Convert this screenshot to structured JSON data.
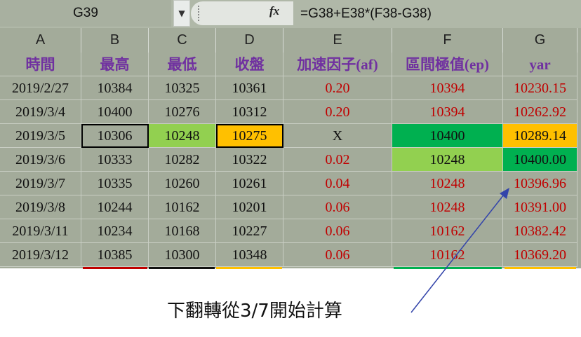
{
  "formula_bar": {
    "name_box": "G39",
    "fx_label": "fx",
    "formula": "=G38+E38*(F38-G38)"
  },
  "columns": [
    "A",
    "B",
    "C",
    "D",
    "E",
    "F",
    "G"
  ],
  "header_row": [
    "時間",
    "最高",
    "最低",
    "收盤",
    "加速因子(af)",
    "區間極值(ep)",
    "yar"
  ],
  "rows": [
    [
      "2019/2/27",
      "10384",
      "10325",
      "10361",
      "0.20",
      "10394",
      "10230.15"
    ],
    [
      "2019/3/4",
      "10400",
      "10276",
      "10312",
      "0.20",
      "10394",
      "10262.92"
    ],
    [
      "2019/3/5",
      "10306",
      "10248",
      "10275",
      "X",
      "10400",
      "10289.14"
    ],
    [
      "2019/3/6",
      "10333",
      "10282",
      "10322",
      "0.02",
      "10248",
      "10400.00"
    ],
    [
      "2019/3/7",
      "10335",
      "10260",
      "10261",
      "0.04",
      "10248",
      "10396.96"
    ],
    [
      "2019/3/8",
      "10244",
      "10162",
      "10201",
      "0.06",
      "10248",
      "10391.00"
    ],
    [
      "2019/3/11",
      "10234",
      "10168",
      "10227",
      "0.06",
      "10162",
      "10382.42"
    ],
    [
      "2019/3/12",
      "10385",
      "10300",
      "10348",
      "0.06",
      "10162",
      "10369.20"
    ]
  ],
  "colors": {
    "header_text": "#7030a0",
    "red_text": "#c00000",
    "highlight_lime": "#92d050",
    "highlight_orange": "#ffc000",
    "highlight_green": "#00b050",
    "arrow": "#3344aa"
  },
  "annotation": {
    "text": "下翻轉從3/7開始計算"
  }
}
